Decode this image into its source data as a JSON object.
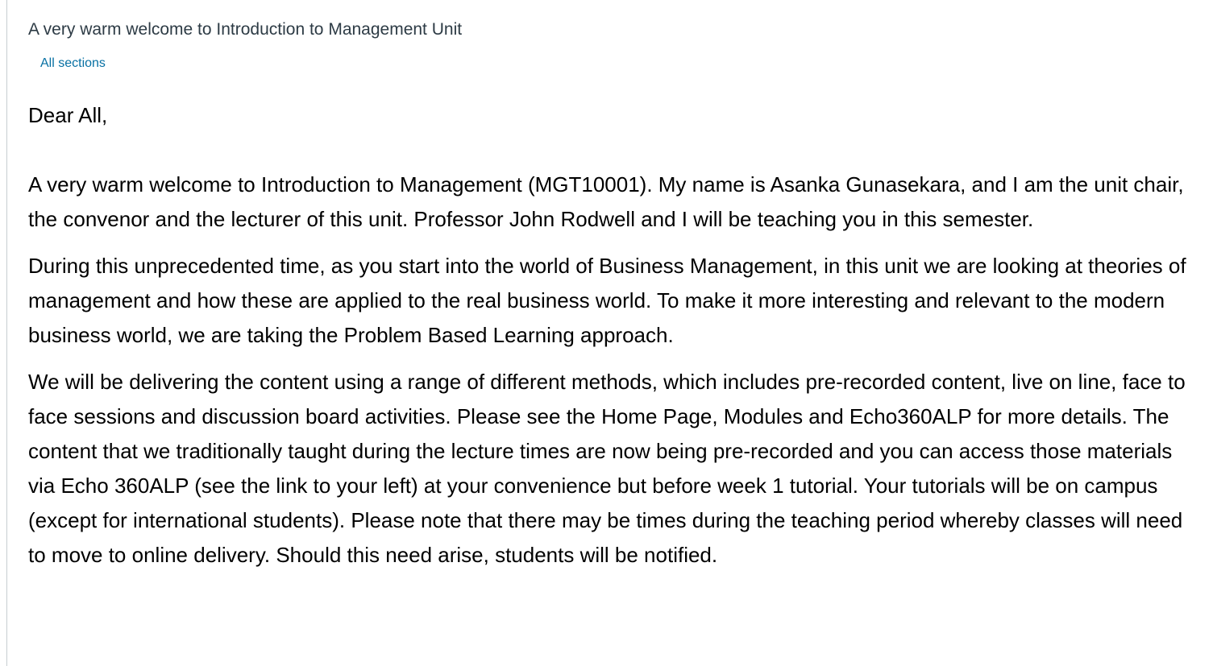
{
  "announcement": {
    "title": "A very warm welcome to Introduction to Management Unit",
    "sections_link": "All sections",
    "link_color": "#0770a3"
  },
  "message": {
    "greeting": "Dear All,",
    "paragraphs": [
      "A very warm welcome to Introduction to Management (MGT10001). My name is Asanka Gunasekara, and I am the unit chair, the convenor and the lecturer of this unit. Professor John Rodwell and I will be teaching you in this semester.",
      "During this unprecedented time, as you start into the world of Business Management, in this unit we are looking at theories of management and how these are applied to the real business world. To make it more interesting and relevant to the modern business world, we are taking the Problem Based Learning approach.",
      "We will be delivering the content using a range of different methods, which includes pre-recorded content, live on line, face to face sessions and discussion board activities. Please see the Home Page, Modules and Echo360ALP for more details. The content that we traditionally taught during the lecture times are now being pre-recorded and you can access those materials via Echo 360ALP (see the link to your left) at your convenience but before week 1 tutorial.  Your tutorials will be on campus (except for international students). Please note that there may be times during the teaching period whereby classes will need to move to online delivery. Should this need arise, students will be notified."
    ]
  }
}
